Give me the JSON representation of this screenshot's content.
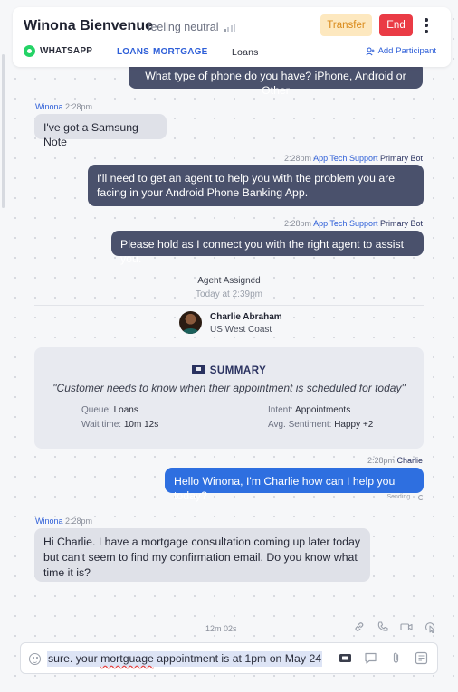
{
  "header": {
    "contact_name": "Winona Bienvenue",
    "sentiment": "feeling neutral",
    "transfer_label": "Transfer",
    "end_label": "End",
    "tabs": {
      "whatsapp": "WHATSAPP",
      "loans": "LOANS",
      "mortgage": "MORTGAGE",
      "loans_plain": "Loans"
    },
    "add_participant": "Add Participant"
  },
  "messages": {
    "m1": {
      "text": "What type of phone do you have? iPhone, Android or Other"
    },
    "m2": {
      "sender": "Winona",
      "time": "2:28pm",
      "text": "I've got a Samsung Note"
    },
    "m3": {
      "time": "2:28pm",
      "sender": "App Tech Support",
      "role": "Primary Bot",
      "text": "I'll need to get an agent to help you with the problem you are facing in your Android Phone Banking App."
    },
    "m4": {
      "time": "2:28pm",
      "sender": "App Tech Support",
      "role": "Primary Bot",
      "text": "Please hold as I connect you with the right agent to assist you."
    },
    "m5": {
      "time": "2:28pm",
      "sender": "Charlie",
      "text": "Hello Winona, I'm Charlie how can I help you today?",
      "status": "Sending..."
    },
    "m6": {
      "sender": "Winona",
      "time": "2:28pm",
      "text": "Hi Charlie. I have a mortgage consultation coming up later today but can't seem to find my confirmation email. Do you know what time it is?"
    }
  },
  "agent_assigned": {
    "label": "Agent Assigned",
    "time": "Today at 2:39pm",
    "agent_name": "Charlie Abraham",
    "agent_location": "US West Coast"
  },
  "summary": {
    "title": "SUMMARY",
    "quote": "\"Customer needs to know when their appointment is scheduled for today\"",
    "queue_label": "Queue:",
    "queue_value": "Loans",
    "wait_label": "Wait time:",
    "wait_value": "10m 12s",
    "intent_label": "Intent:",
    "intent_value": "Appointments",
    "sentiment_label": "Avg. Sentiment:",
    "sentiment_value": "Happy +2"
  },
  "footer": {
    "timer": "12m 02s",
    "composer_before": "sure. your ",
    "composer_misspelled": "mortguage",
    "composer_after": " appointment is at 1pm on May 24"
  },
  "colors": {
    "bot_bubble": "#4a516c",
    "agent_bubble": "#2e6fe0",
    "customer_bubble": "#dfe1e8",
    "accent": "#2e5fd8",
    "end_button": "#ea3b45",
    "transfer_button": "#fde8bf"
  }
}
